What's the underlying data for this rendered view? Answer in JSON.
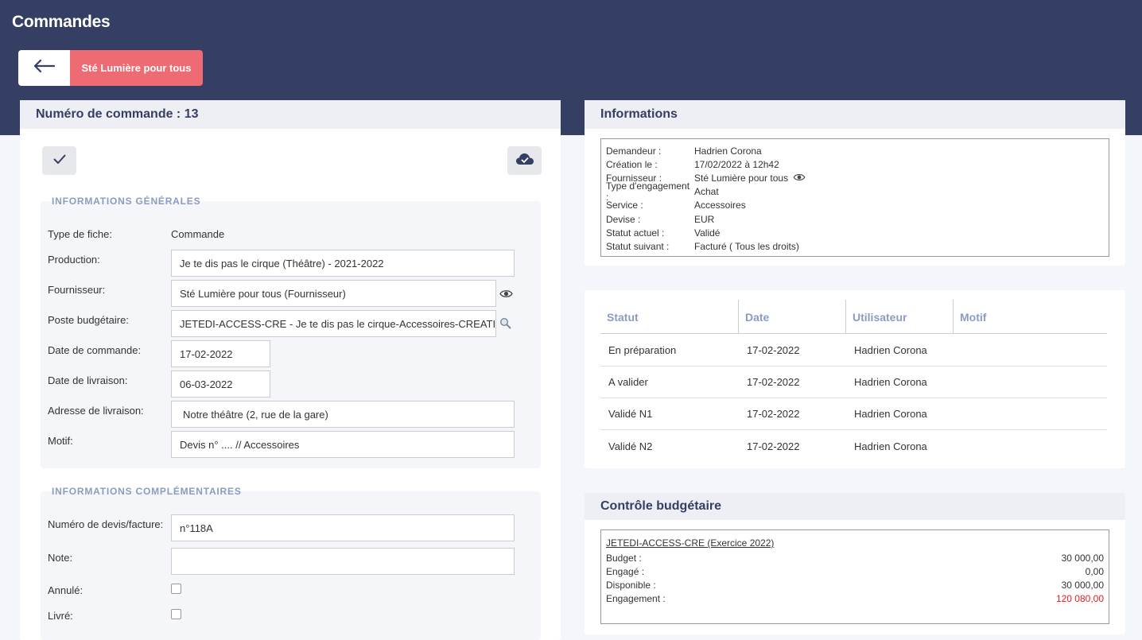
{
  "header": {
    "title": "Commandes",
    "back_icon": "arrow-left-icon",
    "supplier_button": "Sté Lumière pour tous"
  },
  "order": {
    "title": "Numéro de commande : 13",
    "validate_icon": "check-icon",
    "cloud_icon": "cloud-check-icon",
    "general": {
      "title": "INFORMATIONS GÉNÉRALES",
      "type_label": "Type de fiche:",
      "type_value": "Commande",
      "production_label": "Production:",
      "production_value": "Je te dis pas le cirque (Théâtre) - 2021-2022",
      "supplier_label": "Fournisseur:",
      "supplier_value": "Sté Lumière pour tous  (Fournisseur)",
      "budget_post_label": "Poste budgétaire:",
      "budget_post_value": "JETEDI-ACCESS-CRE - Je te dis pas le cirque-Accessoires-CREATION",
      "order_date_label": "Date de commande:",
      "order_date_value": "17-02-2022",
      "delivery_date_label": "Date de livraison:",
      "delivery_date_value": "06-03-2022",
      "address_label": "Adresse de livraison:",
      "address_value": "Notre théâtre (2, rue de la gare)",
      "motive_label": "Motif:",
      "motive_value": "Devis n° .... // Accessoires"
    },
    "complementary": {
      "title": "INFORMATIONS COMPLÉMENTAIRES",
      "quote_label": "Numéro de devis/facture:",
      "quote_value": "n°118A",
      "note_label": "Note:",
      "note_value": "",
      "cancelled_label": "Annulé:",
      "cancelled_checked": false,
      "delivered_label": "Livré:",
      "delivered_checked": false
    }
  },
  "informations": {
    "title": "Informations",
    "rows": [
      {
        "key": "Demandeur :",
        "value": "Hadrien Corona"
      },
      {
        "key": "Création le :",
        "value": "17/02/2022 à 12h42"
      },
      {
        "key": "Fournisseur :",
        "value": "Sté Lumière pour tous"
      },
      {
        "key": "Type d'engagement :",
        "value": "Achat"
      },
      {
        "key": "Service :",
        "value": "Accessoires"
      },
      {
        "key": "Devise :",
        "value": "EUR"
      },
      {
        "key": "Statut actuel :",
        "value": "Validé"
      },
      {
        "key": "Statut suivant :",
        "value": "Facturé ( Tous les droits)"
      }
    ]
  },
  "status_table": {
    "headers": [
      "Statut",
      "Date",
      "Utilisateur",
      "Motif"
    ],
    "rows": [
      [
        "En préparation",
        "17-02-2022",
        "Hadrien Corona",
        ""
      ],
      [
        "A valider",
        "17-02-2022",
        "Hadrien Corona",
        ""
      ],
      [
        "Validé N1",
        "17-02-2022",
        "Hadrien Corona",
        ""
      ],
      [
        "Validé N2",
        "17-02-2022",
        "Hadrien Corona",
        ""
      ]
    ]
  },
  "budget": {
    "title": "Contrôle budgétaire",
    "post": "JETEDI-ACCESS-CRE (Exercice 2022)",
    "rows": [
      {
        "key": "Budget :",
        "value": "30 000,00"
      },
      {
        "key": "Engagé :",
        "value": "0,00"
      },
      {
        "key": "Disponible :",
        "value": "30 000,00"
      },
      {
        "key": "Engagement :",
        "value": "120 080,00",
        "color": "#e02020"
      }
    ]
  },
  "colors": {
    "header_bg": "#353e63",
    "accent": "#ee6b74",
    "section_title": "#8a9cc0",
    "negative": "#e02020"
  }
}
